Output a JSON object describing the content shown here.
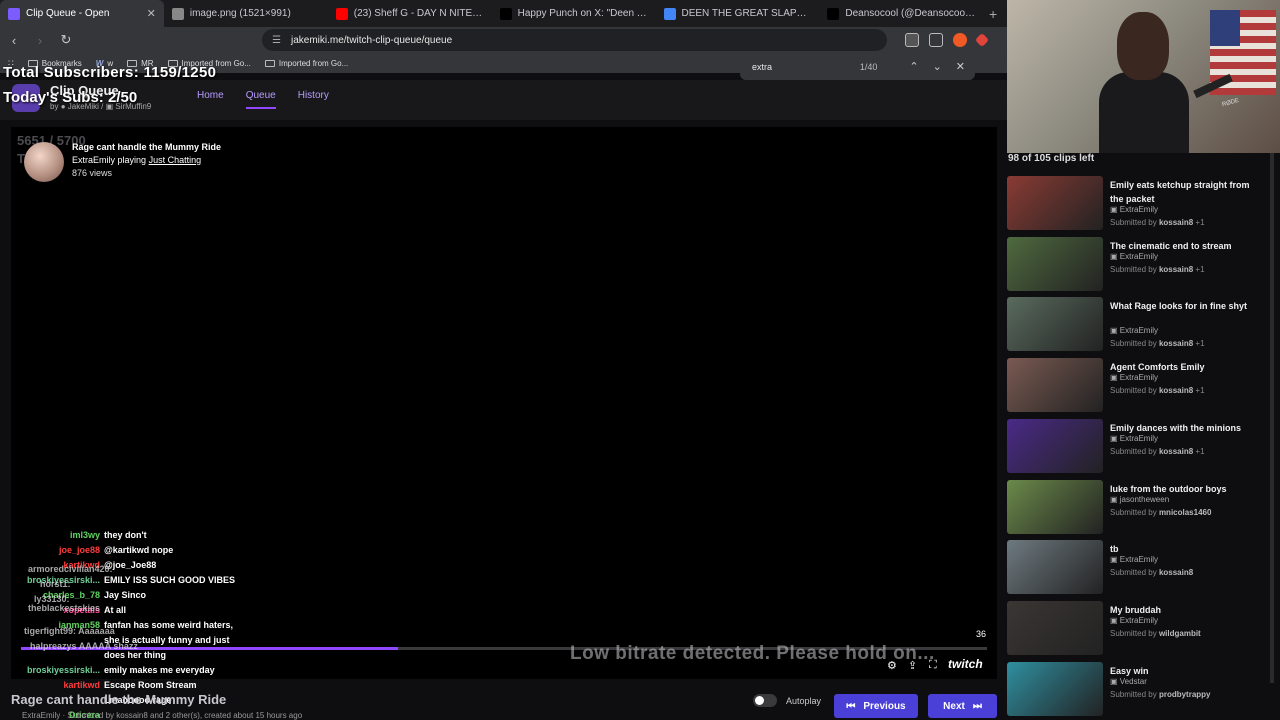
{
  "tabs": [
    {
      "title": "Clip Queue - Open",
      "color": "#7c5cff",
      "active": true
    },
    {
      "title": "image.png (1521×991)",
      "color": "#888888",
      "active": false
    },
    {
      "title": "(23) Sheff G - DAY N NITE Freestyle (\\",
      "color": "#ff0000",
      "active": false
    },
    {
      "title": "Happy Punch on X: \"Deen The Great",
      "color": "#000000",
      "active": false
    },
    {
      "title": "DEEN THE GREAT SLAPPED - Google",
      "color": "#4285f4",
      "active": false
    },
    {
      "title": "Deansocool (@Deansocool) / X",
      "color": "#000000",
      "active": false
    }
  ],
  "url": "jakemiki.me/twitch-clip-queue/queue",
  "bookmarks": [
    {
      "label": "Bookmarks"
    },
    {
      "label": "w"
    },
    {
      "label": "MR"
    },
    {
      "label": "Imported from Go..."
    },
    {
      "label": "Imported from Go..."
    }
  ],
  "find": {
    "query": "extra",
    "count": "1/40"
  },
  "app": {
    "title": "Clip Queue",
    "by": "by",
    "author1": "JakeMiki",
    "author2": "SirMuffin9",
    "nav": [
      {
        "label": "Home"
      },
      {
        "label": "Queue"
      },
      {
        "label": "History"
      }
    ]
  },
  "overlay": {
    "subs": "Total Subscribers: 1159/1250",
    "today": "Today's Subs: 2/50",
    "counter": "5651 / 5700",
    "counter_t": "T"
  },
  "player": {
    "clip_title": "Rage cant handle the Mummy Ride",
    "streamer": "ExtraEmily",
    "playing": "playing",
    "category": "Just Chatting",
    "views": "876 views",
    "time": "36",
    "progress": 0.39,
    "bitrate": "Low bitrate detected. Please hold on...",
    "brand": "twitch"
  },
  "chat": [
    {
      "user": "iml3wy",
      "msg": "they don't",
      "color": "#5fd35f"
    },
    {
      "user": "joe_joe88",
      "msg": "@kartikwd nope",
      "color": "#ff3b3b"
    },
    {
      "user": "kartikwd",
      "msg": "@joe_Joe88",
      "color": "#ff3b3b"
    },
    {
      "user": "broskiyessirski...",
      "msg": "EMILY ISS SUCH GOOD VIBES",
      "color": "#6fcf97"
    },
    {
      "user": "charles_b_78",
      "msg": "Jay Sinco",
      "color": "#5fd35f"
    },
    {
      "user": "xopetals",
      "msg": "At all",
      "color": "#ff4f9a"
    },
    {
      "user": "ianman58",
      "msg": "fanfan has some weird haters,",
      "color": "#5fd35f"
    },
    {
      "user": "",
      "msg": "she is actually funny and just",
      "color": "#ffffff"
    },
    {
      "user": "",
      "msg": "does her thing",
      "color": "#ffffff"
    },
    {
      "user": "broskiyessirski...",
      "msg": "emily makes me      everyday",
      "color": "#6fcf97"
    },
    {
      "user": "kartikwd",
      "msg": "Escape Room Stream",
      "color": "#ff3b3b"
    },
    {
      "user": "",
      "msg": "Lmaooooo rage",
      "color": "#ffffff"
    },
    {
      "user": "Dricera",
      "msg": "",
      "color": "#5fd35f"
    }
  ],
  "chat_ghosts": [
    {
      "text": "armoredcivilian420:",
      "color": "#c06cff"
    },
    {
      "text": "horst1:",
      "color": "#c06cff"
    },
    {
      "text": "ly33130:",
      "color": "#bbbbbb"
    },
    {
      "text": "theblackestskies",
      "color": "#c06cff"
    },
    {
      "text": "tigerfight99:  Aaaaaaa",
      "color": "#c06cff"
    },
    {
      "text": "halpreazys  AAAAA shazz",
      "color": "#c06cff"
    }
  ],
  "below": {
    "title": "Rage cant handle the Mummy Ride",
    "sub": "ExtraEmily · Submitted by kossain8 and 2 other(s), created about 15 hours ago",
    "autoplay": "Autoplay",
    "prev": "Previous",
    "next": "Next"
  },
  "side": {
    "left": "98 of 105 clips left",
    "clips": [
      {
        "title": "Emily eats ketchup straight from the packet",
        "author": "ExtraEmily",
        "by": "kossain8",
        "extra": "+1",
        "thumb": "#8a3b34"
      },
      {
        "title": "The cinematic end to stream",
        "author": "ExtraEmily",
        "by": "kossain8",
        "extra": "+1",
        "thumb": "#4f6a3f"
      },
      {
        "title": "What Rage looks for in fine shyt",
        "author": "ExtraEmily",
        "by": "kossain8",
        "extra": "+1",
        "thumb": "#5a6b5e"
      },
      {
        "title": "Agent Comforts Emily",
        "author": "ExtraEmily",
        "by": "kossain8",
        "extra": "+1",
        "thumb": "#7a5a52"
      },
      {
        "title": "Emily dances with the minions",
        "author": "ExtraEmily",
        "by": "kossain8",
        "extra": "+1",
        "thumb": "#4a2a88"
      },
      {
        "title": "luke from the outdoor boys",
        "author": "jasontheween",
        "by": "mnicolas1460",
        "extra": "",
        "thumb": "#6b8a4a"
      },
      {
        "title": "tb",
        "author": "ExtraEmily",
        "by": "kossain8",
        "extra": "",
        "thumb": "#6e7a80"
      },
      {
        "title": "My bruddah",
        "author": "ExtraEmily",
        "by": "wildgambit",
        "extra": "",
        "thumb": "#3a3634"
      },
      {
        "title": "Easy win",
        "author": "Vedstar",
        "by": "prodbytrappy",
        "extra": "",
        "thumb": "#2f8fa0"
      }
    ],
    "submitted": "Submitted by"
  },
  "webcam": {
    "mic_text": "RØDE"
  }
}
